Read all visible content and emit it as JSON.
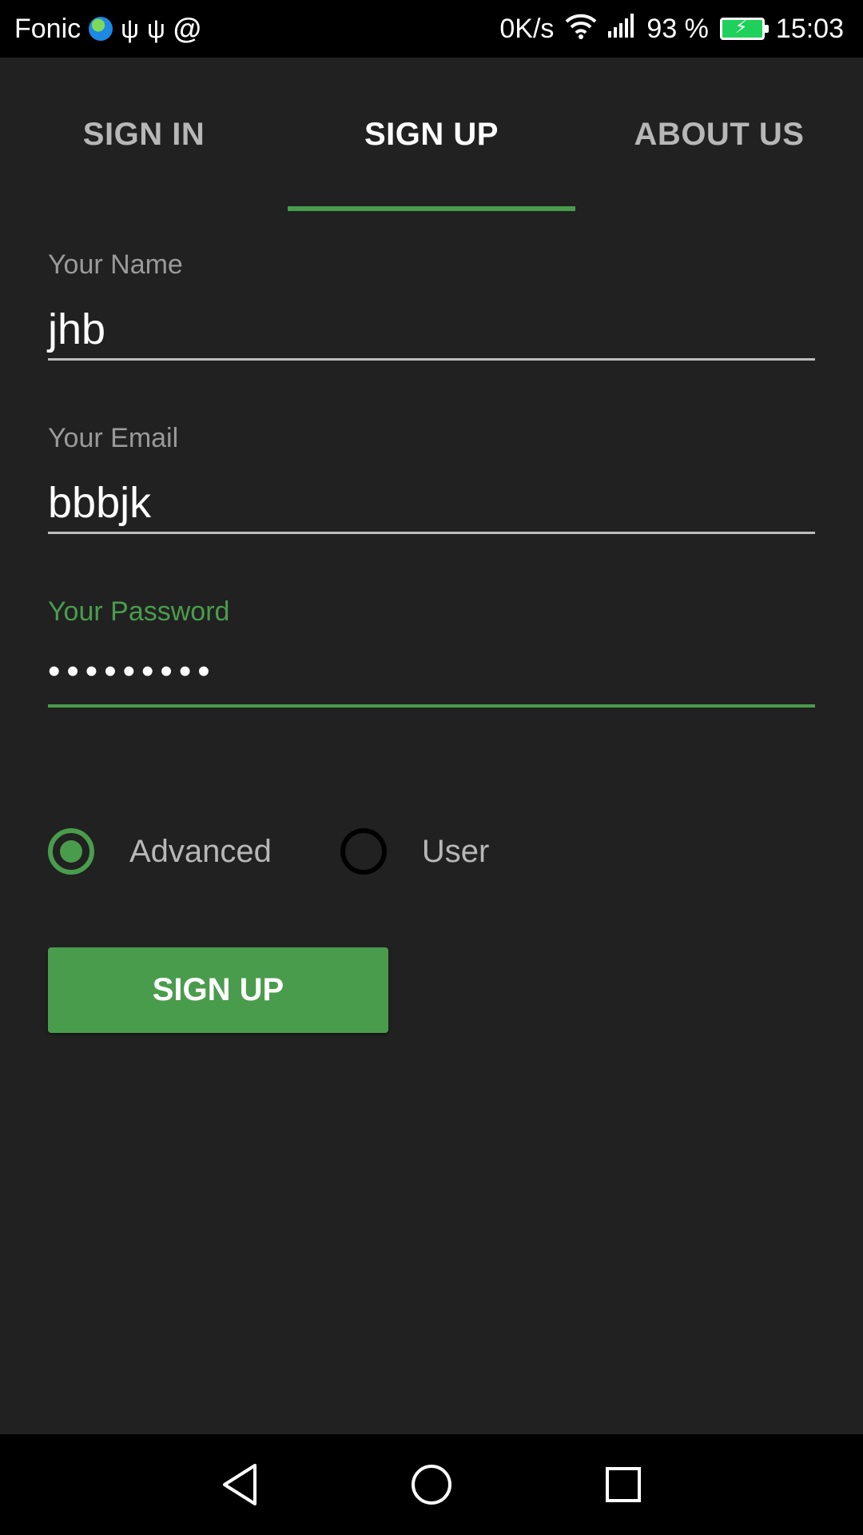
{
  "status_bar": {
    "carrier": "Fonic",
    "speed": "0K/s",
    "battery": "93 %",
    "time": "15:03",
    "icons": [
      "globe-icon",
      "usb-icon",
      "usb-icon",
      "at-icon",
      "wifi-icon",
      "signal-icon",
      "battery-charging-icon"
    ]
  },
  "tabs": [
    {
      "label": "SIGN IN",
      "active": false
    },
    {
      "label": "SIGN UP",
      "active": true
    },
    {
      "label": "ABOUT US",
      "active": false
    }
  ],
  "form": {
    "name_label": "Your Name",
    "name_value": "jhb",
    "email_label": "Your Email",
    "email_value": "bbbjk",
    "password_label": "Your Password",
    "password_value": "•••••••••"
  },
  "roles": {
    "options": [
      {
        "label": "Advanced",
        "checked": true
      },
      {
        "label": "User",
        "checked": false
      }
    ]
  },
  "signup_button": {
    "label": "SIGN UP"
  },
  "colors": {
    "accent": "#4a9c4d",
    "background": "#212121",
    "text_secondary": "#b7b7b7"
  },
  "nav_bar": {
    "icons": [
      "back-icon",
      "home-icon",
      "recents-icon"
    ]
  }
}
